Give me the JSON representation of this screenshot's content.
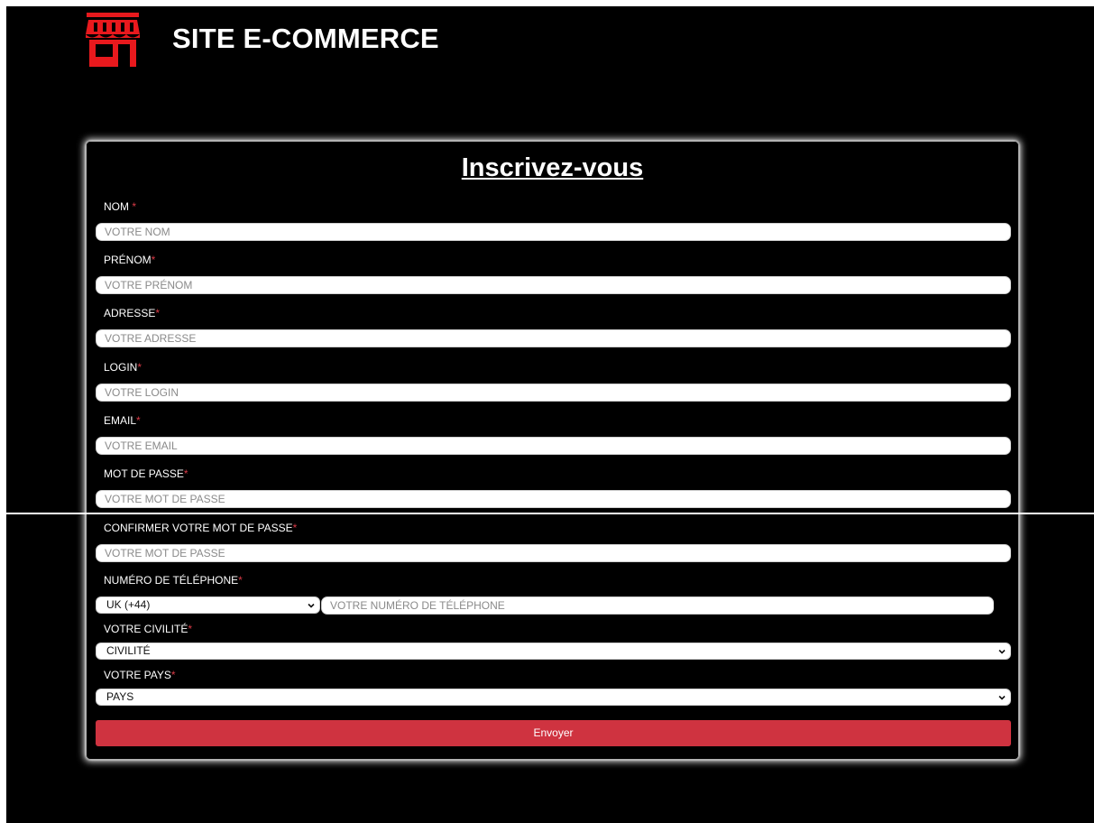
{
  "header": {
    "title": "SITE E-COMMERCE",
    "icon": "storefront-icon",
    "icon_color": "#e8191d"
  },
  "form": {
    "title": "Inscrivez-vous",
    "required_mark": "*",
    "fields": {
      "nom": {
        "label": "NOM ",
        "placeholder": "VOTRE NOM"
      },
      "prenom": {
        "label": "PRÉNOM",
        "placeholder": "VOTRE PRÉNOM"
      },
      "adresse": {
        "label": "ADRESSE",
        "placeholder": "VOTRE ADRESSE"
      },
      "login": {
        "label": "LOGIN",
        "placeholder": "VOTRE LOGIN"
      },
      "email": {
        "label": "EMAIL",
        "placeholder": "VOTRE EMAIL"
      },
      "password": {
        "label": "MOT DE PASSE",
        "placeholder": "VOTRE MOT DE PASSE"
      },
      "confirm": {
        "label": "CONFIRMER VOTRE MOT DE PASSE",
        "placeholder": "VOTRE MOT DE PASSE"
      },
      "phone": {
        "label": "NUMÉRO DE TÉLÉPHONE",
        "country_code": "UK (+44)",
        "placeholder": "VOTRE NUMÉRO DE TÉLÉPHONE"
      },
      "civilite": {
        "label": "VOTRE CIVILITÉ",
        "selected": "CIVILITÉ"
      },
      "pays": {
        "label": "VOTRE PAYS",
        "selected": "PAYS"
      }
    },
    "submit_label": "Envoyer"
  },
  "colors": {
    "background": "#000000",
    "accent": "#cf3340",
    "required": "#d93a46"
  }
}
